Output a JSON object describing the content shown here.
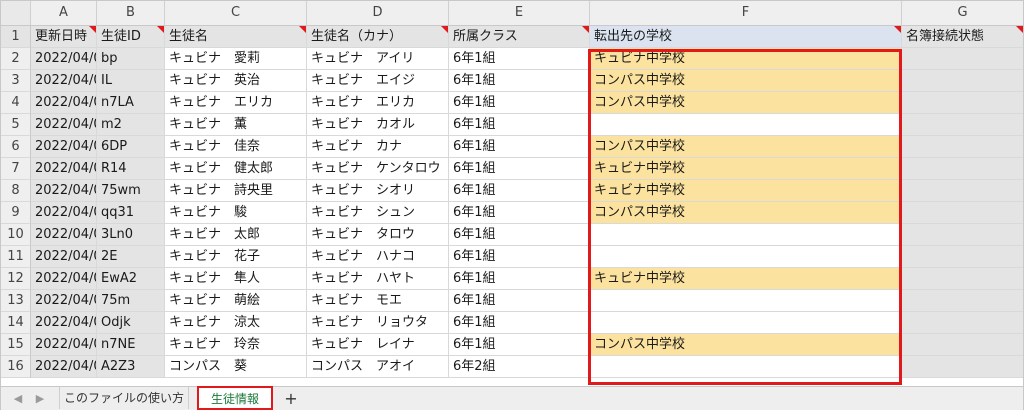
{
  "columns": [
    "A",
    "B",
    "C",
    "D",
    "E",
    "F",
    "G"
  ],
  "headers": {
    "row_number": "1",
    "A": "更新日時",
    "B": "生徒ID",
    "C": "生徒名",
    "D": "生徒名（カナ）",
    "E": "所属クラス",
    "F": "転出先の学校",
    "G": "名簿接続状態"
  },
  "rows": [
    {
      "n": "2",
      "A": "2022/04/0",
      "B": "bp",
      "C": "キュビナ　愛莉",
      "D": "キュビナ　アイリ",
      "E": "6年1組",
      "F": "キュビナ中学校"
    },
    {
      "n": "3",
      "A": "2022/04/0",
      "B": "IL",
      "C": "キュビナ　英治",
      "D": "キュビナ　エイジ",
      "E": "6年1組",
      "F": "コンパス中学校"
    },
    {
      "n": "4",
      "A": "2022/04/0",
      "B": "n7LA",
      "C": "キュビナ　エリカ",
      "D": "キュビナ　エリカ",
      "E": "6年1組",
      "F": "コンパス中学校"
    },
    {
      "n": "5",
      "A": "2022/04/0",
      "B": "m2",
      "C": "キュビナ　薫",
      "D": "キュビナ　カオル",
      "E": "6年1組",
      "F": ""
    },
    {
      "n": "6",
      "A": "2022/04/0",
      "B": "6DP",
      "C": "キュビナ　佳奈",
      "D": "キュビナ　カナ",
      "E": "6年1組",
      "F": "コンパス中学校"
    },
    {
      "n": "7",
      "A": "2022/04/0",
      "B": "R14",
      "C": "キュビナ　健太郎",
      "D": "キュビナ　ケンタロウ",
      "E": "6年1組",
      "F": "キュビナ中学校"
    },
    {
      "n": "8",
      "A": "2022/04/0",
      "B": "75wm",
      "C": "キュビナ　詩央里",
      "D": "キュビナ　シオリ",
      "E": "6年1組",
      "F": "キュビナ中学校"
    },
    {
      "n": "9",
      "A": "2022/04/0",
      "B": "qq31",
      "C": "キュビナ　駿",
      "D": "キュビナ　シュン",
      "E": "6年1組",
      "F": "コンパス中学校"
    },
    {
      "n": "10",
      "A": "2022/04/0",
      "B": "3Ln0",
      "C": "キュビナ　太郎",
      "D": "キュビナ　タロウ",
      "E": "6年1組",
      "F": ""
    },
    {
      "n": "11",
      "A": "2022/04/0",
      "B": "2E",
      "C": "キュビナ　花子",
      "D": "キュビナ　ハナコ",
      "E": "6年1組",
      "F": ""
    },
    {
      "n": "12",
      "A": "2022/04/0",
      "B": "EwA2",
      "C": "キュビナ　隼人",
      "D": "キュビナ　ハヤト",
      "E": "6年1組",
      "F": "キュビナ中学校"
    },
    {
      "n": "13",
      "A": "2022/04/0",
      "B": "75m",
      "C": "キュビナ　萌絵",
      "D": "キュビナ　モエ",
      "E": "6年1組",
      "F": ""
    },
    {
      "n": "14",
      "A": "2022/04/0",
      "B": "Odjk",
      "C": "キュビナ　涼太",
      "D": "キュビナ　リョウタ",
      "E": "6年1組",
      "F": ""
    },
    {
      "n": "15",
      "A": "2022/04/0",
      "B": "n7NE",
      "C": "キュビナ　玲奈",
      "D": "キュビナ　レイナ",
      "E": "6年1組",
      "F": "コンパス中学校"
    },
    {
      "n": "16",
      "A": "2022/04/0",
      "B": "A2Z3",
      "C": "コンパス　葵",
      "D": "コンパス　アオイ",
      "E": "6年2組",
      "F": ""
    }
  ],
  "tabs": [
    "このファイルの使い方",
    "生徒情報"
  ],
  "active_tab": "生徒情報",
  "add_sheet_label": "+",
  "nav_prev_icon": "◀",
  "nav_next_icon": "▶",
  "colors": {
    "filled": "#fbe29e",
    "selection_border": "#e0191c",
    "active_tab_text": "#1a7a3a"
  }
}
